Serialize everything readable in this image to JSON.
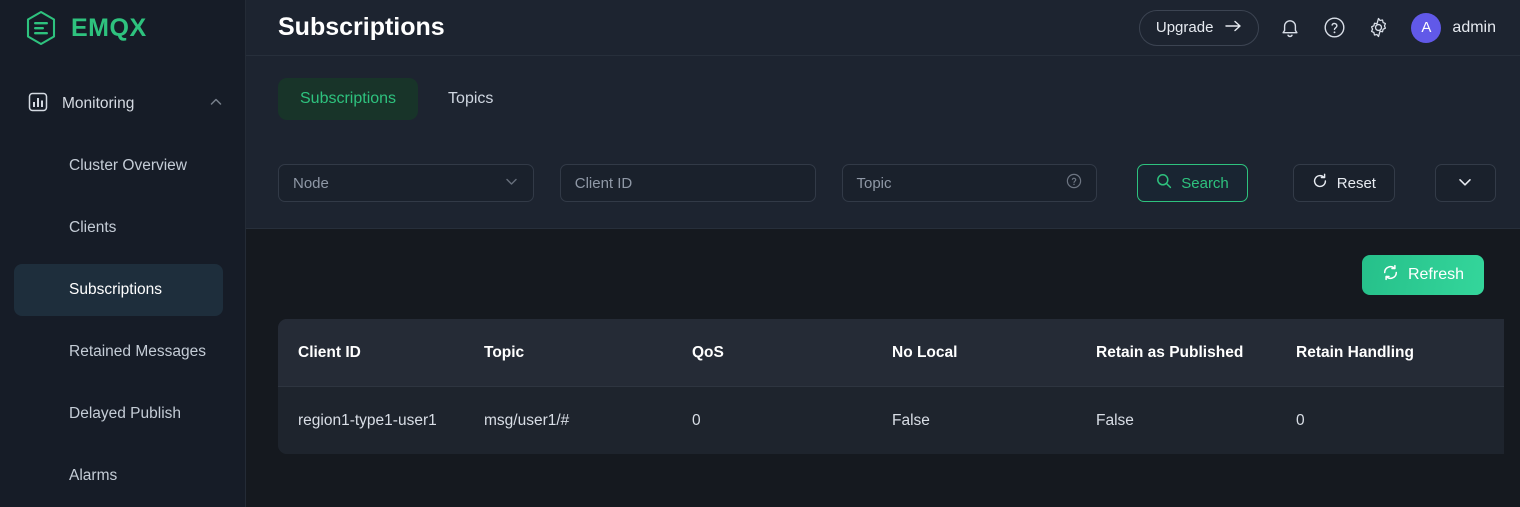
{
  "brand": {
    "name": "EMQX",
    "logo_icon": "emqx-hexagon-logo",
    "color": "#2ec27e"
  },
  "sidebar": {
    "group": {
      "label": "Monitoring",
      "icon": "bar-chart-icon",
      "collapse_icon": "chevron-up-icon"
    },
    "items": [
      {
        "label": "Cluster Overview",
        "active": false
      },
      {
        "label": "Clients",
        "active": false
      },
      {
        "label": "Subscriptions",
        "active": true
      },
      {
        "label": "Retained Messages",
        "active": false
      },
      {
        "label": "Delayed Publish",
        "active": false
      },
      {
        "label": "Alarms",
        "active": false
      }
    ]
  },
  "header": {
    "title": "Subscriptions",
    "upgrade_label": "Upgrade",
    "upgrade_icon": "arrow-right-icon",
    "bell_icon": "bell-icon",
    "help_icon": "question-circle-icon",
    "settings_icon": "gear-icon",
    "avatar_initial": "A",
    "avatar_color": "#6159e8",
    "username": "admin"
  },
  "tabs": [
    {
      "label": "Subscriptions",
      "active": true
    },
    {
      "label": "Topics",
      "active": false
    }
  ],
  "filters": {
    "node": {
      "placeholder": "Node",
      "value": "",
      "icon": "chevron-down-icon"
    },
    "client_id": {
      "placeholder": "Client ID",
      "value": ""
    },
    "topic": {
      "placeholder": "Topic",
      "value": "",
      "icon": "question-circle-icon"
    },
    "search_label": "Search",
    "search_icon": "search-icon",
    "reset_label": "Reset",
    "reset_icon": "refresh-ccw-icon",
    "expand_icon": "chevron-down-icon"
  },
  "toolbar": {
    "refresh_label": "Refresh",
    "refresh_icon": "refresh-icon"
  },
  "table": {
    "columns": [
      "Client ID",
      "Topic",
      "QoS",
      "No Local",
      "Retain as Published",
      "Retain Handling"
    ],
    "rows": [
      {
        "client_id": "region1-type1-user1",
        "topic": "msg/user1/#",
        "qos": "0",
        "no_local": "False",
        "retain_as_published": "False",
        "retain_handling": "0"
      }
    ]
  }
}
